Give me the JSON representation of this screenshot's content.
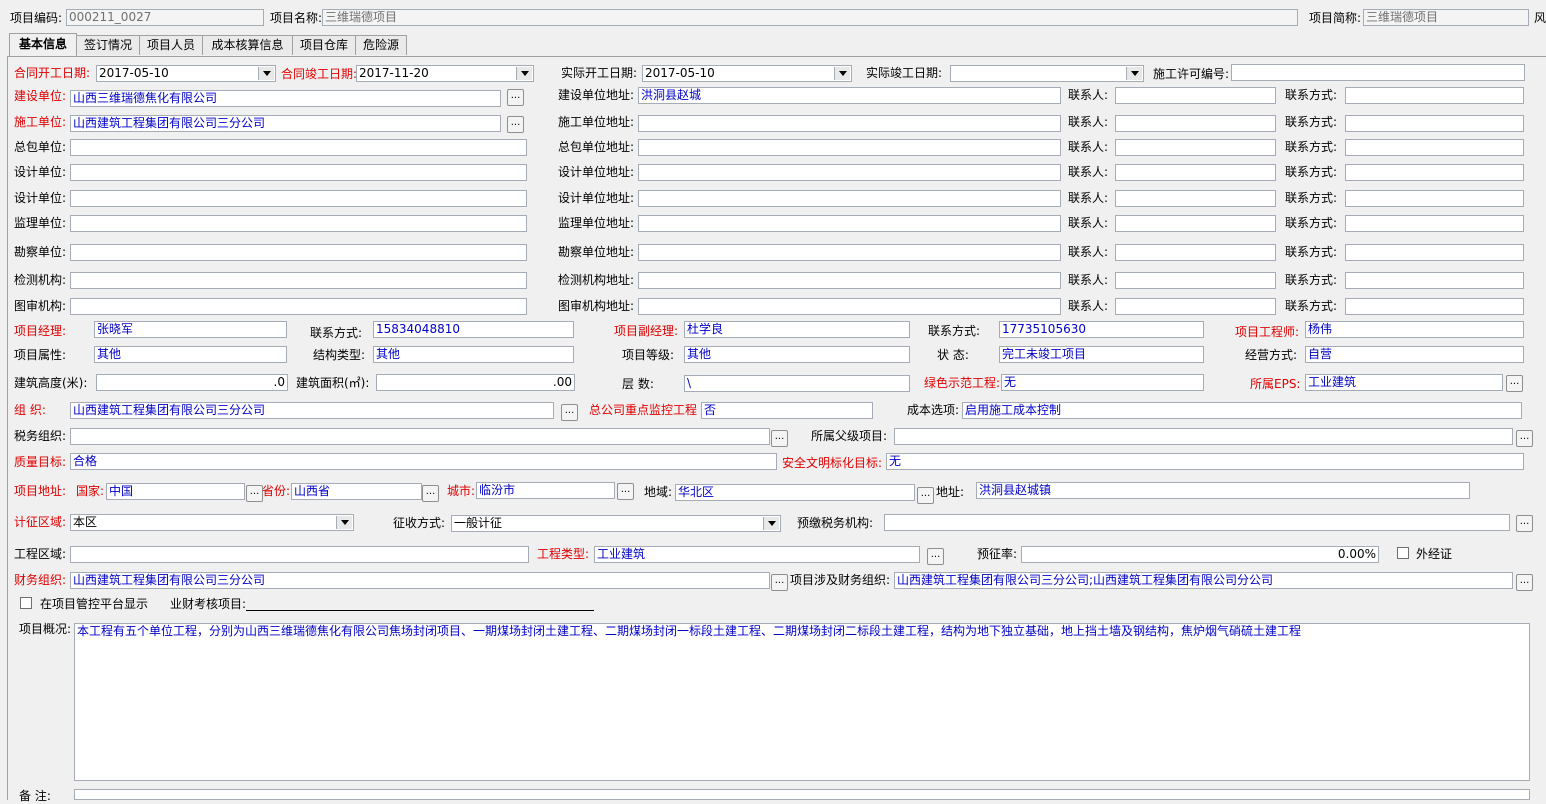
{
  "header": {
    "project_code_label": "项目编码:",
    "project_code": "000211_0027",
    "project_name_label": "项目名称:",
    "project_name": "三维瑞德项目",
    "project_short_label": "项目简称:",
    "project_short": "三维瑞德项目",
    "cut_label": "风"
  },
  "tabs": [
    "基本信息",
    "签订情况",
    "项目人员",
    "成本核算信息",
    "项目仓库",
    "危险源"
  ],
  "dates": {
    "contract_start_label": "合同开工日期:",
    "contract_start": "2017-05-10",
    "contract_end_label": "合同竣工日期:",
    "contract_end": "2017-11-20",
    "actual_start_label": "实际开工日期:",
    "actual_start": "2017-05-10",
    "actual_end_label": "实际竣工日期:",
    "actual_end": "",
    "permit_label": "施工许可编号:",
    "permit": ""
  },
  "orgs": [
    {
      "label": "建设单位:",
      "value": "山西三维瑞德焦化有限公司",
      "addr_label": "建设单位地址:",
      "addr": "洪洞县赵城",
      "contact_label": "联系人:",
      "contact": "",
      "phone_label": "联系方式:",
      "phone": ""
    },
    {
      "label": "施工单位:",
      "value": "山西建筑工程集团有限公司三分公司",
      "addr_label": "施工单位地址:",
      "addr": "",
      "contact_label": "联系人:",
      "contact": "",
      "phone_label": "联系方式:",
      "phone": ""
    },
    {
      "label": "总包单位:",
      "value": "",
      "addr_label": "总包单位地址:",
      "addr": "",
      "contact_label": "联系人:",
      "contact": "",
      "phone_label": "联系方式:",
      "phone": ""
    },
    {
      "label": "设计单位:",
      "value": "",
      "addr_label": "设计单位地址:",
      "addr": "",
      "contact_label": "联系人:",
      "contact": "",
      "phone_label": "联系方式:",
      "phone": ""
    },
    {
      "label": "设计单位:",
      "value": "",
      "addr_label": "设计单位地址:",
      "addr": "",
      "contact_label": "联系人:",
      "contact": "",
      "phone_label": "联系方式:",
      "phone": ""
    },
    {
      "label": "监理单位:",
      "value": "",
      "addr_label": "监理单位地址:",
      "addr": "",
      "contact_label": "联系人:",
      "contact": "",
      "phone_label": "联系方式:",
      "phone": ""
    },
    {
      "label": "勘察单位:",
      "value": "",
      "addr_label": "勘察单位地址:",
      "addr": "",
      "contact_label": "联系人:",
      "contact": "",
      "phone_label": "联系方式:",
      "phone": ""
    },
    {
      "label": "检测机构:",
      "value": "",
      "addr_label": "检测机构地址:",
      "addr": "",
      "contact_label": "联系人:",
      "contact": "",
      "phone_label": "联系方式:",
      "phone": ""
    },
    {
      "label": "图审机构:",
      "value": "",
      "addr_label": "图审机构地址:",
      "addr": "",
      "contact_label": "联系人:",
      "contact": "",
      "phone_label": "联系方式:",
      "phone": ""
    }
  ],
  "people": {
    "manager_label": "项目经理:",
    "manager": "张晓军",
    "manager_phone_label": "联系方式:",
    "manager_phone": "15834048810",
    "deputy_label": "项目副经理:",
    "deputy": "杜学良",
    "deputy_phone_label": "联系方式:",
    "deputy_phone": "17735105630",
    "engineer_label": "项目工程师:",
    "engineer": "杨伟"
  },
  "attrs": {
    "property_label": "项目属性:",
    "property": "其他",
    "structure_label": "结构类型:",
    "structure": "其他",
    "grade_label": "项目等级:",
    "grade": "其他",
    "status_label": "状    态:",
    "status": "完工未竣工项目",
    "mode_label": "经营方式:",
    "mode": "自营"
  },
  "measures": {
    "height_label": "建筑高度(米):",
    "height": ".0",
    "area_label": "建筑面积(㎡):",
    "area": ".00",
    "floors_label": "层    数:",
    "floors": "\\",
    "green_label": "绿色示范工程:",
    "green": "无",
    "eps_label": "所属EPS:",
    "eps": "工业建筑"
  },
  "org": {
    "org_label": "组    织:",
    "org": "山西建筑工程集团有限公司三分公司",
    "monitor_label": "总公司重点监控工程",
    "monitor": "否",
    "cost_label": "成本选项:",
    "cost": "启用施工成本控制",
    "tax_label": "税务组织:",
    "tax": "",
    "parent_label": "所属父级项目:",
    "parent": "",
    "quality_label": "质量目标:",
    "quality": "合格",
    "safety_label": "安全文明标化目标:",
    "safety": "无"
  },
  "location": {
    "addr_label": "项目地址:",
    "country_label": "国家:",
    "country": "中国",
    "province_label": "省份:",
    "province": "山西省",
    "city_label": "城市:",
    "city": "临汾市",
    "region_label": "地域:",
    "region": "华北区",
    "address_label": "地址:",
    "address": "洪洞县赵城镇"
  },
  "tax": {
    "zone_label": "计征区域:",
    "zone": "本区",
    "method_label": "征收方式:",
    "method": "一般计征",
    "prepay_label": "预缴税务机构:",
    "prepay": "",
    "eng_zone_label": "工程区域:",
    "eng_zone": "",
    "eng_type_label": "工程类型:",
    "eng_type": "工业建筑",
    "rate_label": "预征率:",
    "rate": "0.00%",
    "external_label": "外经证"
  },
  "finance": {
    "fin_org_label": "财务组织:",
    "fin_org": "山西建筑工程集团有限公司三分公司",
    "related_label": "项目涉及财务组织:",
    "related": "山西建筑工程集团有限公司三分公司;山西建筑工程集团有限公司分公司",
    "show_platform_label": "在项目管控平台显示",
    "assess_label": "业财考核项目:"
  },
  "overview": {
    "label": "项目概况:",
    "text": "本工程有五个单位工程，分别为山西三维瑞德焦化有限公司焦场封闭项目、一期煤场封闭土建工程、二期煤场封闭一标段土建工程、二期煤场封闭二标段土建工程，结构为地下独立基础，地上挡土墙及钢结构，焦炉烟气硝硫土建工程",
    "remark_label": "备    注:"
  },
  "ellipsis": "..."
}
